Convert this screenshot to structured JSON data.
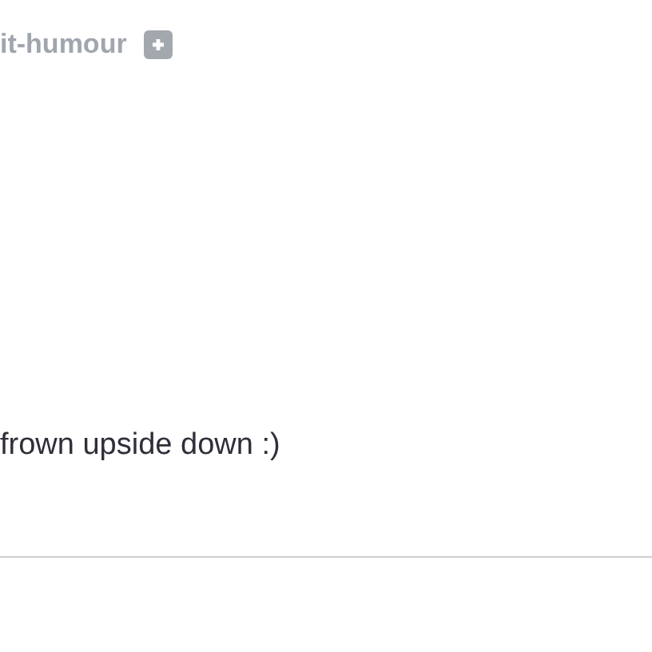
{
  "tag": {
    "label": "it-humour"
  },
  "post": {
    "text": "frown upside down :)"
  }
}
